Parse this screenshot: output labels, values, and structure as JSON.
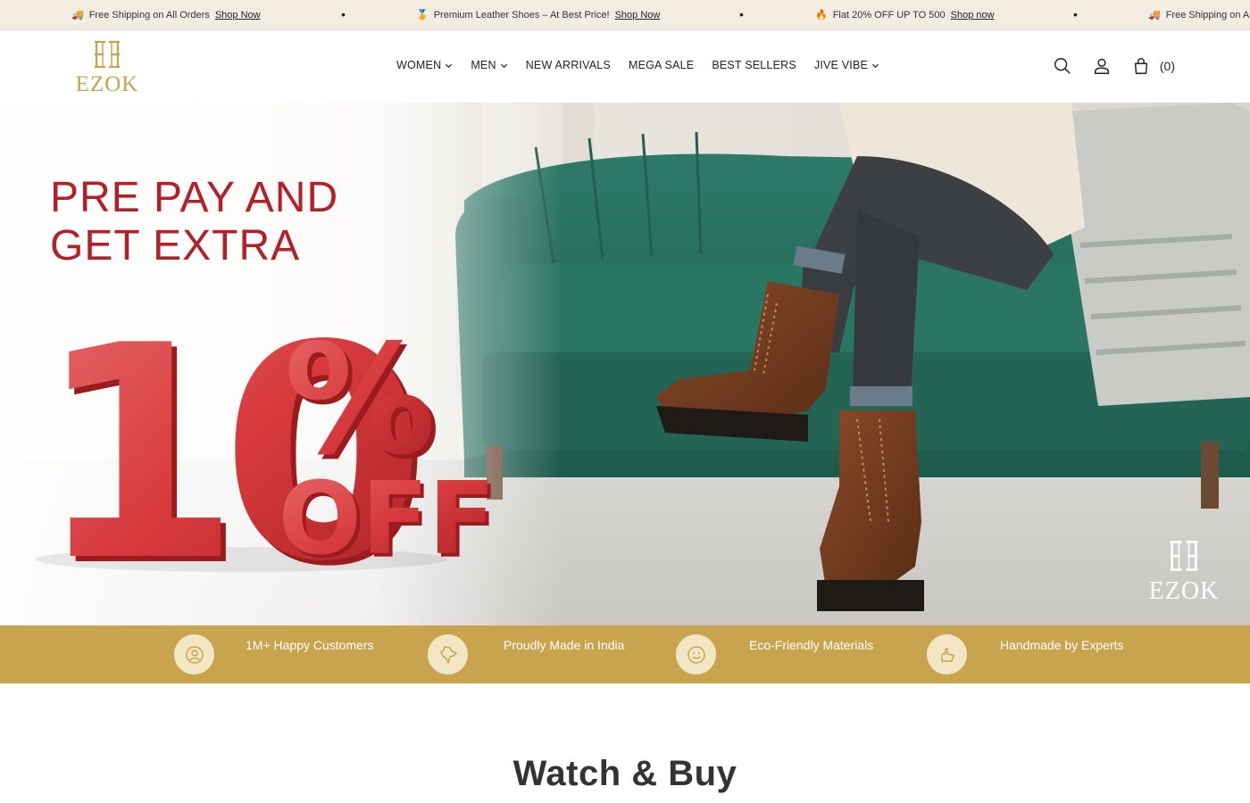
{
  "announcement": {
    "items": [
      {
        "emoji": "🚚",
        "text": "Free Shipping on All Orders",
        "link": "Shop Now"
      },
      {
        "emoji": "🏅",
        "text": "Premium Leather Shoes – At Best Price!",
        "link": "Shop Now"
      },
      {
        "emoji": "🔥",
        "text": "Flat 20% OFF UP TO 500",
        "link": "Shop now"
      },
      {
        "emoji": "🚚",
        "text": "Free Shipping on All Orders",
        "link": ""
      }
    ],
    "separator": "•"
  },
  "header": {
    "logo_text": "EZOK",
    "nav": [
      {
        "label": "WOMEN",
        "has_dropdown": true
      },
      {
        "label": "MEN",
        "has_dropdown": true
      },
      {
        "label": "NEW ARRIVALS",
        "has_dropdown": false
      },
      {
        "label": "MEGA SALE",
        "has_dropdown": false
      },
      {
        "label": "BEST SELLERS",
        "has_dropdown": false
      },
      {
        "label": "JIVE VIBE",
        "has_dropdown": true
      }
    ],
    "cart_count": "(0)",
    "icons": [
      "search-icon",
      "account-icon",
      "cart-icon"
    ]
  },
  "hero": {
    "headline_line1": "PRE PAY AND",
    "headline_line2": "GET EXTRA",
    "discount_number": "10",
    "discount_symbol": "%",
    "discount_word": "OFF",
    "watermark_text": "EZOK",
    "accent_color": "#b3202a"
  },
  "features": [
    {
      "label": "1M+ Happy Customers",
      "icon": "happy-customers-icon"
    },
    {
      "label": "Proudly Made in India",
      "icon": "india-map-icon"
    },
    {
      "label": "Eco-Friendly Materials",
      "icon": "smiley-icon"
    },
    {
      "label": "Handmade by Experts",
      "icon": "hand-icon"
    }
  ],
  "brand_gold": "#c9a44e",
  "section": {
    "title": "Watch & Buy"
  }
}
